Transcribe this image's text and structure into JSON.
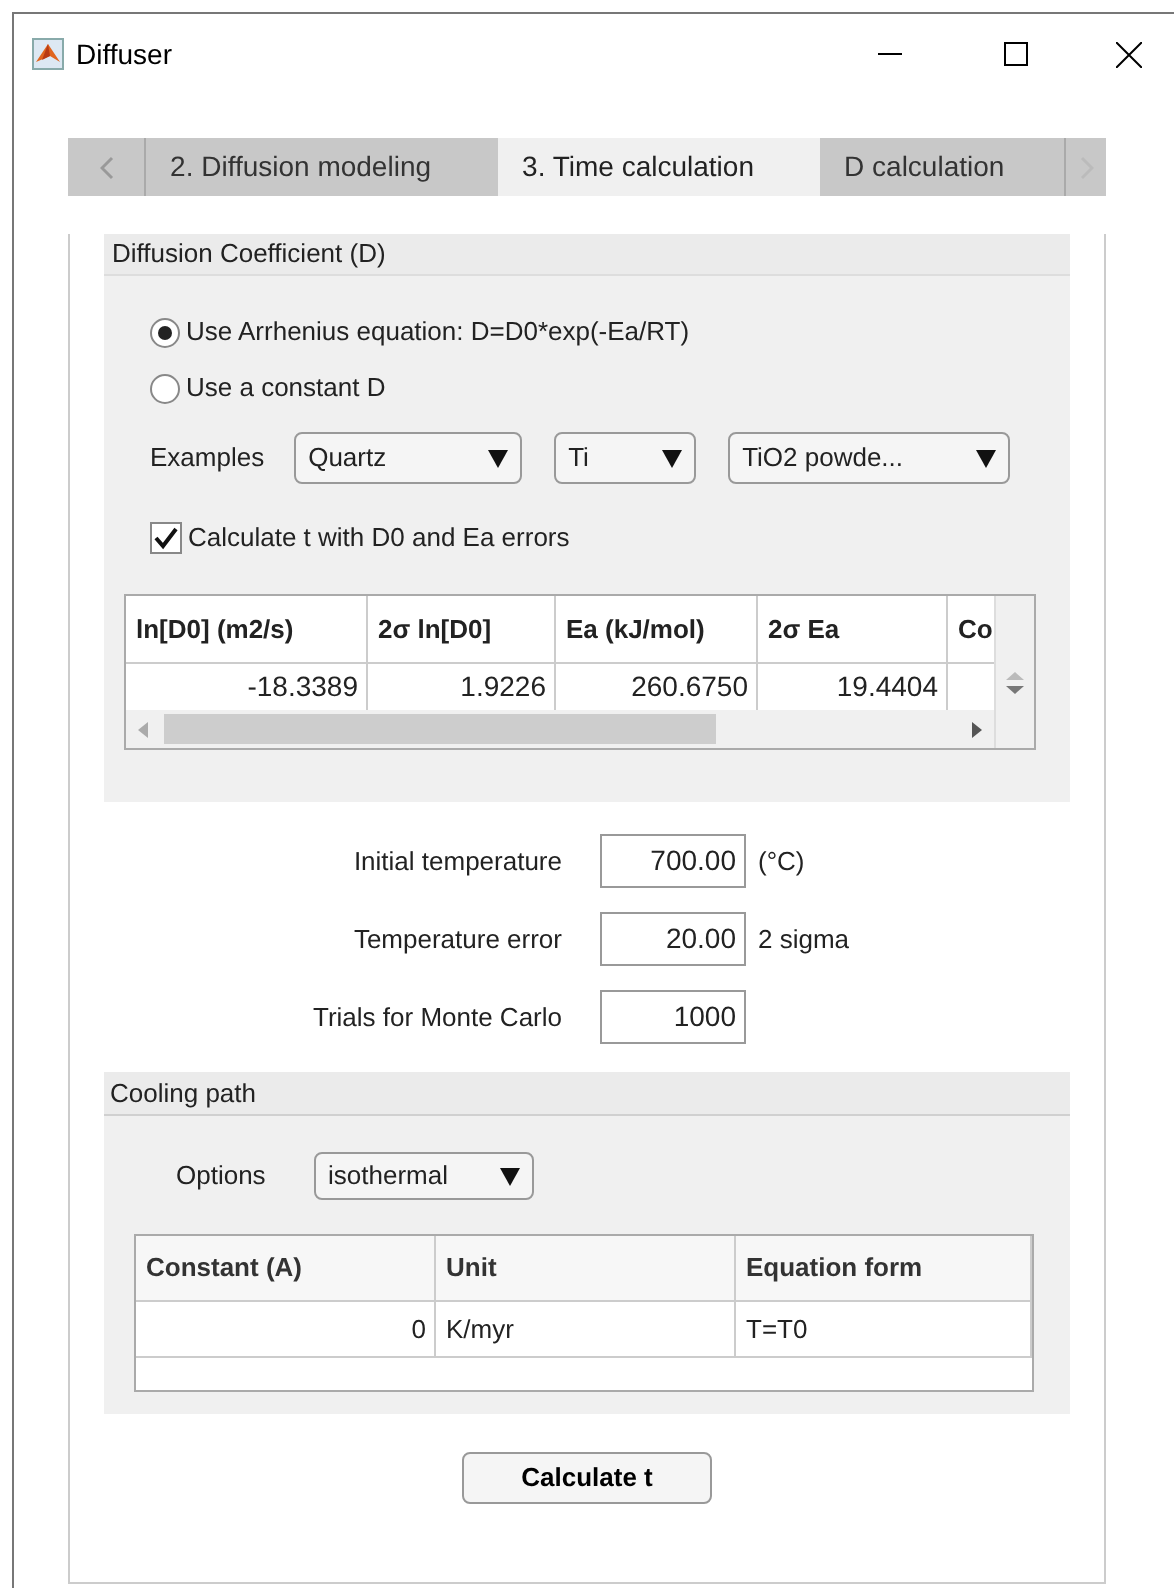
{
  "window": {
    "title": "Diffuser"
  },
  "tabs": [
    {
      "label": "2. Diffusion modeling",
      "selected": false
    },
    {
      "label": "3. Time calculation",
      "selected": true
    },
    {
      "label": "D calculation",
      "selected": false
    }
  ],
  "diffusion_panel": {
    "title": "Diffusion Coefficient (D)",
    "options": [
      {
        "label": "Use Arrhenius equation: D=D0*exp(-Ea/RT)",
        "selected": true
      },
      {
        "label": "Use a constant D",
        "selected": false
      }
    ],
    "examples_label": "Examples",
    "dropdowns": [
      "Quartz",
      "Ti",
      "TiO2 powde..."
    ],
    "error_checkbox": {
      "label": "Calculate t with D0 and Ea errors",
      "checked": true
    },
    "table": {
      "columns": [
        "ln[D0] (m2/s)",
        "2σ ln[D0]",
        "Ea (kJ/mol)",
        "2σ Ea",
        "Co"
      ],
      "rows": [
        [
          "-18.3389",
          "1.9226",
          "260.6750",
          "19.4404"
        ]
      ]
    }
  },
  "inputs": [
    {
      "label": "Initial temperature",
      "value": "700.00",
      "unit": "(°C)"
    },
    {
      "label": "Temperature error",
      "value": "20.00",
      "unit": "2 sigma"
    },
    {
      "label": "Trials for Monte Carlo",
      "value": "1000"
    }
  ],
  "cooling_panel": {
    "title": "Cooling path",
    "options_label": "Options",
    "option_value": "isothermal",
    "table": {
      "columns": [
        "Constant (A)",
        "Unit",
        "Equation form"
      ],
      "rows": [
        [
          "0",
          "K/myr",
          "T=T0"
        ]
      ]
    }
  },
  "button": "Calculate t"
}
